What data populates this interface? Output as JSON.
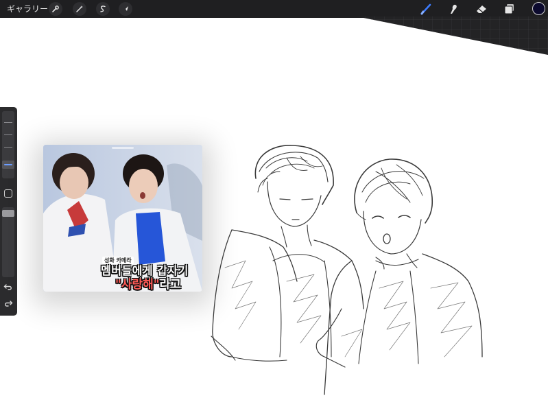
{
  "app": {
    "gallery_label": "ギャラリー"
  },
  "toolbar": {
    "left_tools": [
      {
        "name": "actions",
        "icon": "wrench-icon"
      },
      {
        "name": "adjustments",
        "icon": "magic-wand-icon"
      },
      {
        "name": "selection",
        "icon": "selection-s-icon"
      },
      {
        "name": "transform",
        "icon": "arrow-cursor-icon"
      }
    ],
    "right_tools": [
      {
        "name": "brush",
        "icon": "brush-icon",
        "active": true
      },
      {
        "name": "smudge",
        "icon": "smudge-finger-icon"
      },
      {
        "name": "eraser",
        "icon": "eraser-icon"
      },
      {
        "name": "layers",
        "icon": "layers-icon"
      }
    ],
    "current_color": "#0c0a2e",
    "active_color": "#3d7cff"
  },
  "reference_image": {
    "caption_tag": "성화 카메라",
    "caption_line1": "멤버들에게 갑자기",
    "caption_line2_highlight": "\"사랑해\"",
    "caption_line2_rest": "라고",
    "highlight_color": "#ff5b57"
  }
}
